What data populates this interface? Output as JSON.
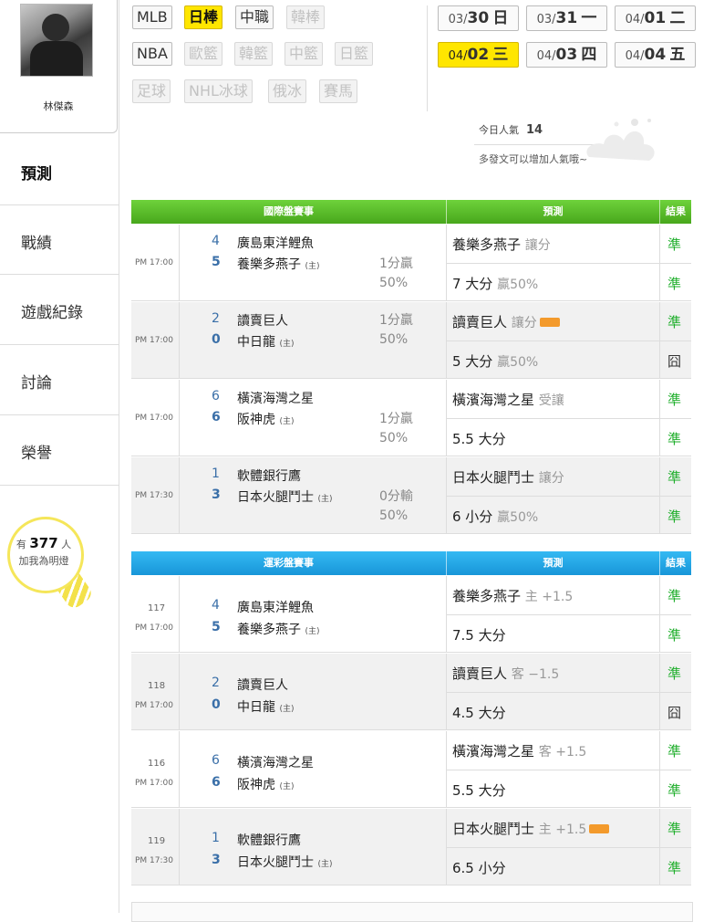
{
  "profile": {
    "name": "林傑森"
  },
  "nav": [
    "預測",
    "戰績",
    "遊戲紀錄",
    "討論",
    "榮譽"
  ],
  "bulb": {
    "prefix": "有",
    "count": "377",
    "suffix": "人",
    "line2": "加我為明燈"
  },
  "leagues": [
    {
      "label": "MLB",
      "state": "normal"
    },
    {
      "label": "日棒",
      "state": "active"
    },
    {
      "label": "中職",
      "state": "normal"
    },
    {
      "label": "韓棒",
      "state": "dim"
    },
    {
      "label": "NBA",
      "state": "normal"
    },
    {
      "label": "歐籃",
      "state": "dim"
    },
    {
      "label": "韓籃",
      "state": "dim"
    },
    {
      "label": "中籃",
      "state": "dim"
    },
    {
      "label": "日籃",
      "state": "dim"
    },
    {
      "label": "足球",
      "state": "dim"
    },
    {
      "label": "NHL冰球",
      "state": "dim"
    },
    {
      "label": "俄冰",
      "state": "dim"
    },
    {
      "label": "賽馬",
      "state": "dim"
    }
  ],
  "dates": [
    {
      "md": "03/",
      "d": "30",
      "w": "日",
      "active": false
    },
    {
      "md": "03/",
      "d": "31",
      "w": "一",
      "active": false
    },
    {
      "md": "04/",
      "d": "01",
      "w": "二",
      "active": false
    },
    {
      "md": "04/",
      "d": "02",
      "w": "三",
      "active": true
    },
    {
      "md": "04/",
      "d": "03",
      "w": "四",
      "active": false
    },
    {
      "md": "04/",
      "d": "04",
      "w": "五",
      "active": false
    }
  ],
  "popularity": {
    "label": "今日人氣",
    "value": "14",
    "hint": "多發文可以增加人氣哦~"
  },
  "intl": {
    "title": "國際盤賽事",
    "pred_header": "預測",
    "result_header": "結果",
    "home_mark": "(主)",
    "games": [
      {
        "time": "PM 17:00",
        "away_score": "4",
        "home_score": "5",
        "away": "廣島東洋鯉魚",
        "home": "養樂多燕子",
        "line_pos": "home",
        "line1": "1分贏",
        "line2": "50%",
        "p1": "養樂多燕子",
        "p1sub": "讓分",
        "p1badge": false,
        "r1": "準",
        "p2": "7 大分",
        "p2sub": "贏50%",
        "r2": "準"
      },
      {
        "time": "PM 17:00",
        "away_score": "2",
        "home_score": "0",
        "away": "讀賣巨人",
        "home": "中日龍",
        "line_pos": "away",
        "line1": "1分贏",
        "line2": "50%",
        "p1": "讀賣巨人",
        "p1sub": "讓分",
        "p1badge": true,
        "r1": "準",
        "p2": "5 大分",
        "p2sub": "贏50%",
        "r2": "囧"
      },
      {
        "time": "PM 17:00",
        "away_score": "6",
        "home_score": "6",
        "away": "橫濱海灣之星",
        "home": "阪神虎",
        "line_pos": "home",
        "line1": "1分贏",
        "line2": "50%",
        "p1": "橫濱海灣之星",
        "p1sub": "受讓",
        "p1badge": false,
        "r1": "準",
        "p2": "5.5 大分",
        "p2sub": "",
        "r2": "準"
      },
      {
        "time": "PM 17:30",
        "away_score": "1",
        "home_score": "3",
        "away": "軟體銀行鷹",
        "home": "日本火腿鬥士",
        "line_pos": "home",
        "line1": "0分輸",
        "line2": "50%",
        "p1": "日本火腿鬥士",
        "p1sub": "讓分",
        "p1badge": false,
        "r1": "準",
        "p2": "6 小分",
        "p2sub": "贏50%",
        "r2": "準"
      }
    ]
  },
  "lottery": {
    "title": "運彩盤賽事",
    "pred_header": "預測",
    "result_header": "結果",
    "home_mark": "(主)",
    "games": [
      {
        "id": "117",
        "time": "PM 17:00",
        "away_score": "4",
        "home_score": "5",
        "away": "廣島東洋鯉魚",
        "home": "養樂多燕子",
        "p1": "養樂多燕子",
        "p1sub": "主 +1.5",
        "p1badge": false,
        "r1": "準",
        "p2": "7.5 大分",
        "r2": "準"
      },
      {
        "id": "118",
        "time": "PM 17:00",
        "away_score": "2",
        "home_score": "0",
        "away": "讀賣巨人",
        "home": "中日龍",
        "p1": "讀賣巨人",
        "p1sub": "客 −1.5",
        "p1badge": false,
        "r1": "準",
        "p2": "4.5 大分",
        "r2": "囧"
      },
      {
        "id": "116",
        "time": "PM 17:00",
        "away_score": "6",
        "home_score": "6",
        "away": "橫濱海灣之星",
        "home": "阪神虎",
        "p1": "橫濱海灣之星",
        "p1sub": "客 +1.5",
        "p1badge": false,
        "r1": "準",
        "p2": "5.5 大分",
        "r2": "準"
      },
      {
        "id": "119",
        "time": "PM 17:30",
        "away_score": "1",
        "home_score": "3",
        "away": "軟體銀行鷹",
        "home": "日本火腿鬥士",
        "p1": "日本火腿鬥士",
        "p1sub": "主 +1.5",
        "p1badge": true,
        "r1": "準",
        "p2": "6.5 小分",
        "r2": "準"
      }
    ]
  },
  "colors": {
    "win": "#1fae2b",
    "active": "#ffe600",
    "intl_header": "#55b326",
    "lottery_header": "#1ea5e6"
  }
}
